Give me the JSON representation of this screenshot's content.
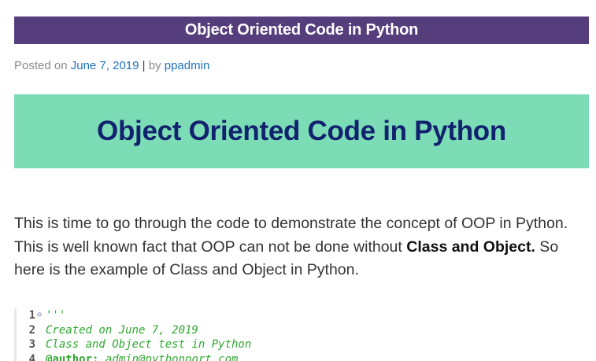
{
  "header": {
    "title": "Object Oriented Code in Python"
  },
  "meta": {
    "posted_prefix": "Posted on",
    "date": "June 7, 2019",
    "separator": "|",
    "by_prefix": "by",
    "author": "ppadmin"
  },
  "hero": {
    "heading": "Object Oriented Code in Python"
  },
  "paragraph": {
    "part1": "This is time to go through the code to demonstrate the concept of OOP in Python. This is well known fact that OOP can not be done without ",
    "bold": "Class and Object.",
    "part2": " So here is the example of Class and Object in Python."
  },
  "code": {
    "lines": [
      {
        "num": "1",
        "text": "'''"
      },
      {
        "num": "2",
        "text": "Created on June 7, 2019"
      },
      {
        "num": "3",
        "text": "Class and Object test in Python"
      },
      {
        "num": "4",
        "tag": "@author:",
        "text": " admin@pythonport.com"
      }
    ]
  },
  "colors": {
    "title_bar": "#563d7c",
    "hero_bg": "#7cdcb6",
    "hero_text": "#12226e",
    "link": "#1e73be",
    "code_comment": "#2fa82f"
  }
}
